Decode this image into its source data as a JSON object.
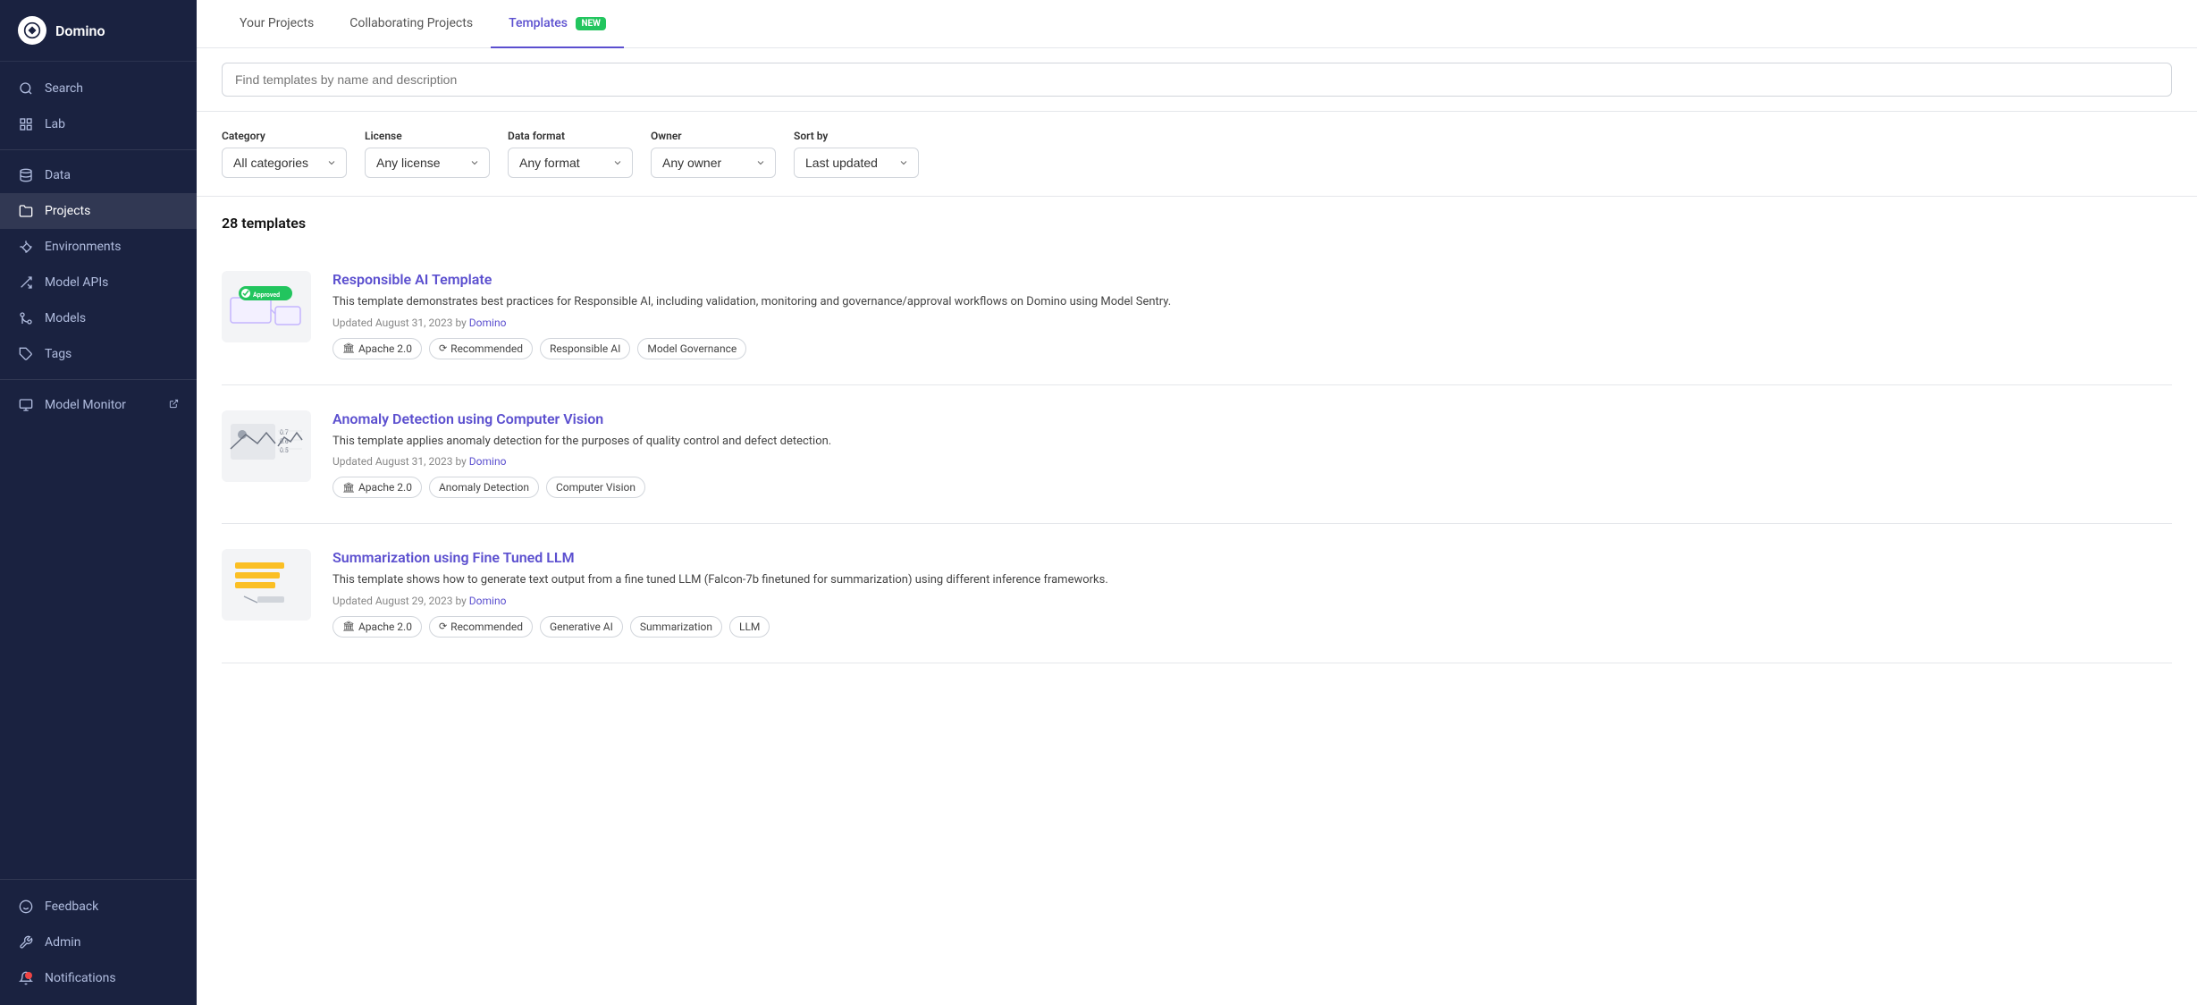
{
  "sidebar": {
    "logo_text": "Domino",
    "items": [
      {
        "id": "search",
        "label": "Search",
        "icon": "search"
      },
      {
        "id": "lab",
        "label": "Lab",
        "icon": "grid"
      },
      {
        "id": "data",
        "label": "Data",
        "icon": "database"
      },
      {
        "id": "projects",
        "label": "Projects",
        "icon": "folder",
        "active": true
      },
      {
        "id": "environments",
        "label": "Environments",
        "icon": "box"
      },
      {
        "id": "model-apis",
        "label": "Model APIs",
        "icon": "model-apis"
      },
      {
        "id": "models",
        "label": "Models",
        "icon": "models"
      },
      {
        "id": "tags",
        "label": "Tags",
        "icon": "tag"
      },
      {
        "id": "model-monitor",
        "label": "Model Monitor",
        "icon": "external",
        "external": true
      }
    ],
    "bottom_items": [
      {
        "id": "feedback",
        "label": "Feedback",
        "icon": "smile"
      },
      {
        "id": "admin",
        "label": "Admin",
        "icon": "wrench"
      },
      {
        "id": "notifications",
        "label": "Notifications",
        "icon": "bell",
        "has_dot": true
      }
    ]
  },
  "tabs": [
    {
      "id": "your-projects",
      "label": "Your Projects",
      "active": false
    },
    {
      "id": "collaborating-projects",
      "label": "Collaborating Projects",
      "active": false
    },
    {
      "id": "templates",
      "label": "Templates",
      "active": true,
      "badge": "NEW"
    }
  ],
  "search": {
    "placeholder": "Find templates by name and description"
  },
  "filters": [
    {
      "id": "category",
      "label": "Category",
      "value": "All categories",
      "options": [
        "All categories"
      ]
    },
    {
      "id": "license",
      "label": "License",
      "value": "Any license",
      "options": [
        "Any license"
      ]
    },
    {
      "id": "data-format",
      "label": "Data format",
      "value": "Any format",
      "options": [
        "Any format"
      ]
    },
    {
      "id": "owner",
      "label": "Owner",
      "value": "Any owner",
      "options": [
        "Any owner"
      ]
    },
    {
      "id": "sort-by",
      "label": "Sort by",
      "value": "Last updated",
      "options": [
        "Last updated"
      ]
    }
  ],
  "templates_count": "28 templates",
  "templates": [
    {
      "id": "responsible-ai",
      "title": "Responsible AI Template",
      "description": "This template demonstrates best practices for Responsible AI, including validation, monitoring and governance/approval workflows on Domino using Model Sentry.",
      "updated": "Updated August 31, 2023 by",
      "updated_by": "Domino",
      "tags": [
        {
          "icon": "bank",
          "label": "Apache 2.0"
        },
        {
          "icon": "recommended",
          "label": "Recommended"
        },
        {
          "icon": "",
          "label": "Responsible AI"
        },
        {
          "icon": "",
          "label": "Model Governance"
        }
      ]
    },
    {
      "id": "anomaly-detection",
      "title": "Anomaly Detection using Computer Vision",
      "description": "This template applies anomaly detection for the purposes of quality control and defect detection.",
      "updated": "Updated August 31, 2023 by",
      "updated_by": "Domino",
      "tags": [
        {
          "icon": "bank",
          "label": "Apache 2.0"
        },
        {
          "icon": "",
          "label": "Anomaly Detection"
        },
        {
          "icon": "",
          "label": "Computer Vision"
        }
      ]
    },
    {
      "id": "summarization-llm",
      "title": "Summarization using Fine Tuned LLM",
      "description": "This template shows how to generate text output from a fine tuned LLM (Falcon-7b finetuned for summarization) using different inference frameworks.",
      "updated": "Updated August 29, 2023 by",
      "updated_by": "Domino",
      "tags": [
        {
          "icon": "bank",
          "label": "Apache 2.0"
        },
        {
          "icon": "recommended",
          "label": "Recommended"
        },
        {
          "icon": "",
          "label": "Generative AI"
        },
        {
          "icon": "",
          "label": "Summarization"
        },
        {
          "icon": "",
          "label": "LLM"
        }
      ]
    }
  ]
}
